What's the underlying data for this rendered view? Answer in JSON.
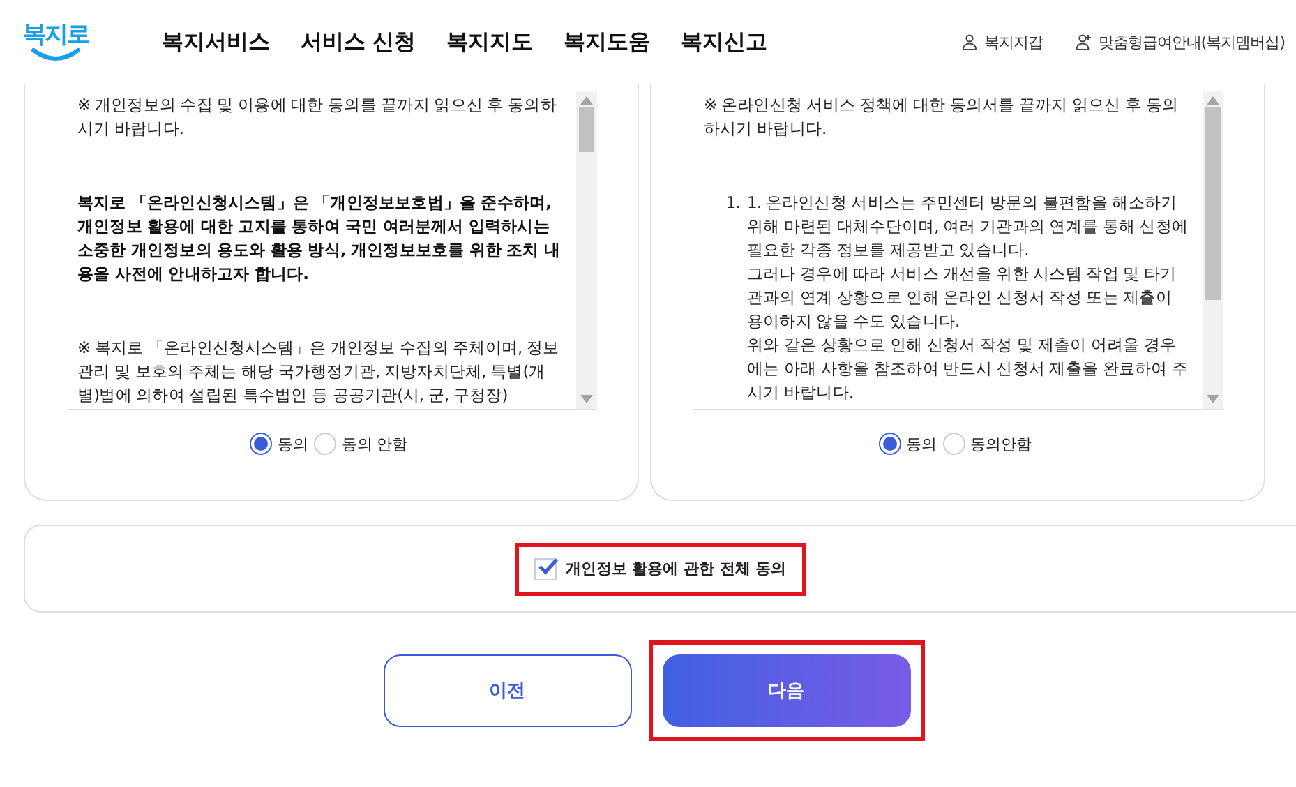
{
  "header": {
    "logo": "복지로",
    "nav": [
      "복지서비스",
      "서비스 신청",
      "복지지도",
      "복지도움",
      "복지신고"
    ],
    "links": [
      {
        "kind": "person",
        "label": "복지지갑"
      },
      {
        "kind": "person-add",
        "label": "맞춤형급여안내(복지멤버십)"
      }
    ]
  },
  "agreements": [
    {
      "kind": "paragraphs",
      "notice": "※ 개인정보의 수집 및 이용에 대한 동의를 끝까지 읽으신 후 동의하시기 바랍니다.",
      "blocks": [
        {
          "bold": true,
          "text": "복지로 「온라인신청시스템」은 「개인정보보호법」을 준수하며, 개인정보 활용에 대한 고지를 통하여 국민 여러분께서 입력하시는 소중한 개인정보의 용도와 활용 방식, 개인정보보호를 위한 조치 내용을 사전에 안내하고자 합니다."
        },
        {
          "bold": false,
          "text": "※ 복지로 「온라인신청시스템」은 개인정보 수집의 주체이며, 정보 관리 및 보호의 주체는 해당 국가행정기관, 지방자치단체, 특별(개별)법에 의하여 설립된 특수법인 등 공공기관(시, 군, 구청장)"
        }
      ],
      "options": [
        {
          "label": "동의",
          "selected": true
        },
        {
          "label": "동의 안함",
          "selected": false
        }
      ]
    },
    {
      "kind": "list",
      "notice": "※ 온라인신청 서비스 정책에 대한 동의서를 끝까지 읽으신 후 동의하시기 바랍니다.",
      "items": [
        {
          "number": "1.",
          "paragraphs": [
            "1. 온라인신청 서비스는 주민센터 방문의 불편함을 해소하기 위해 마련된 대체수단이며, 여러 기관과의 연계를 통해 신청에 필요한 각종 정보를 제공받고 있습니다.",
            "그러나 경우에 따라 서비스 개선을 위한 시스템 작업 및 타기관과의 연계 상황으로 인해 온라인 신청서 작성 또는 제출이 용이하지 않을 수도 있습니다.",
            "위와 같은 상황으로 인해 신청서 작성 및 제출이 어려울 경우에는 아래 사항을 참조하여 반드시 신청서 제출을 완료하여 주시기 바랍니다."
          ]
        }
      ],
      "options": [
        {
          "label": "동의",
          "selected": true
        },
        {
          "label": "동의안함",
          "selected": false
        }
      ]
    }
  ],
  "agree_all": {
    "label": "개인정보 활용에 관한 전체 동의",
    "checked": true,
    "highlighted": true
  },
  "buttons": [
    {
      "kind": "secondary",
      "label": "이전",
      "highlighted": false
    },
    {
      "kind": "primary",
      "label": "다음",
      "highlighted": true
    }
  ]
}
